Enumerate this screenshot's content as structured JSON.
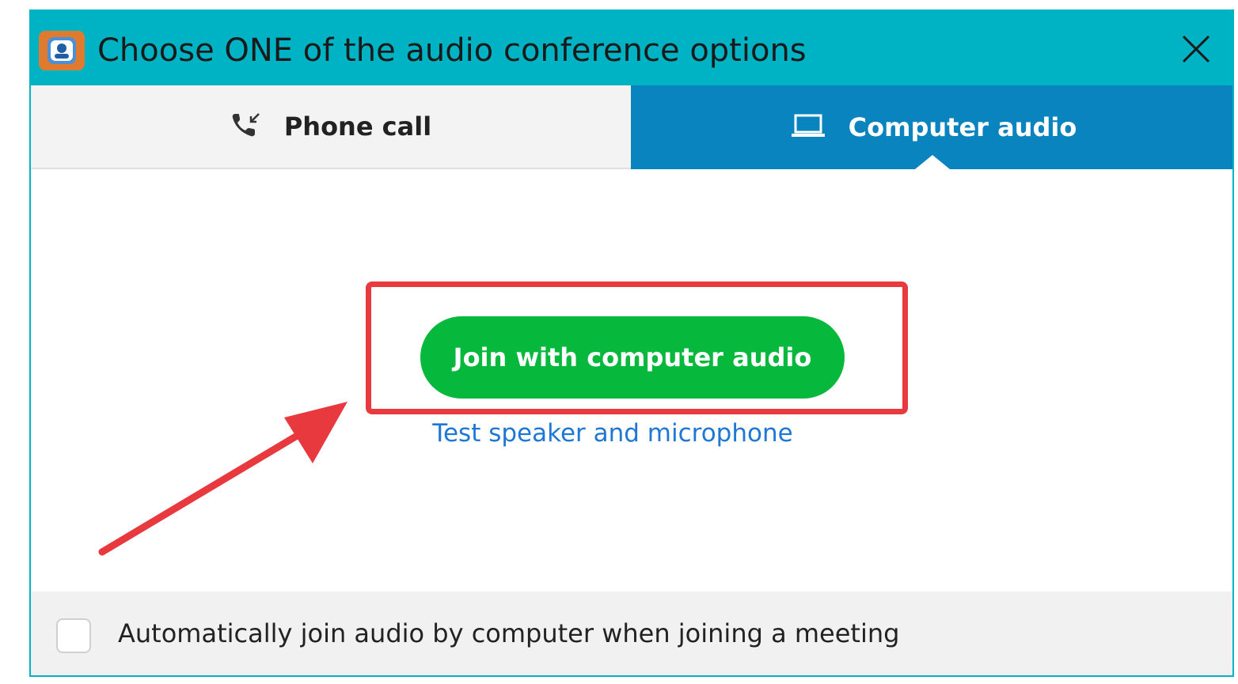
{
  "window": {
    "title": "Choose ONE of the audio conference options"
  },
  "tabs": [
    {
      "label": "Phone call",
      "icon": "phone-incoming-icon",
      "selected": false
    },
    {
      "label": "Computer audio",
      "icon": "laptop-icon",
      "selected": true
    }
  ],
  "main": {
    "join_button_label": "Join with computer audio",
    "test_link_label": "Test speaker and microphone"
  },
  "footer": {
    "auto_join_label": "Automatically join audio by computer when joining a meeting",
    "auto_join_checked": false
  },
  "colors": {
    "titlebar": "#00b3c4",
    "tab_active": "#0a84bf",
    "join_button": "#06b83c",
    "link": "#1e77d3",
    "annotation": "#e8393f"
  }
}
